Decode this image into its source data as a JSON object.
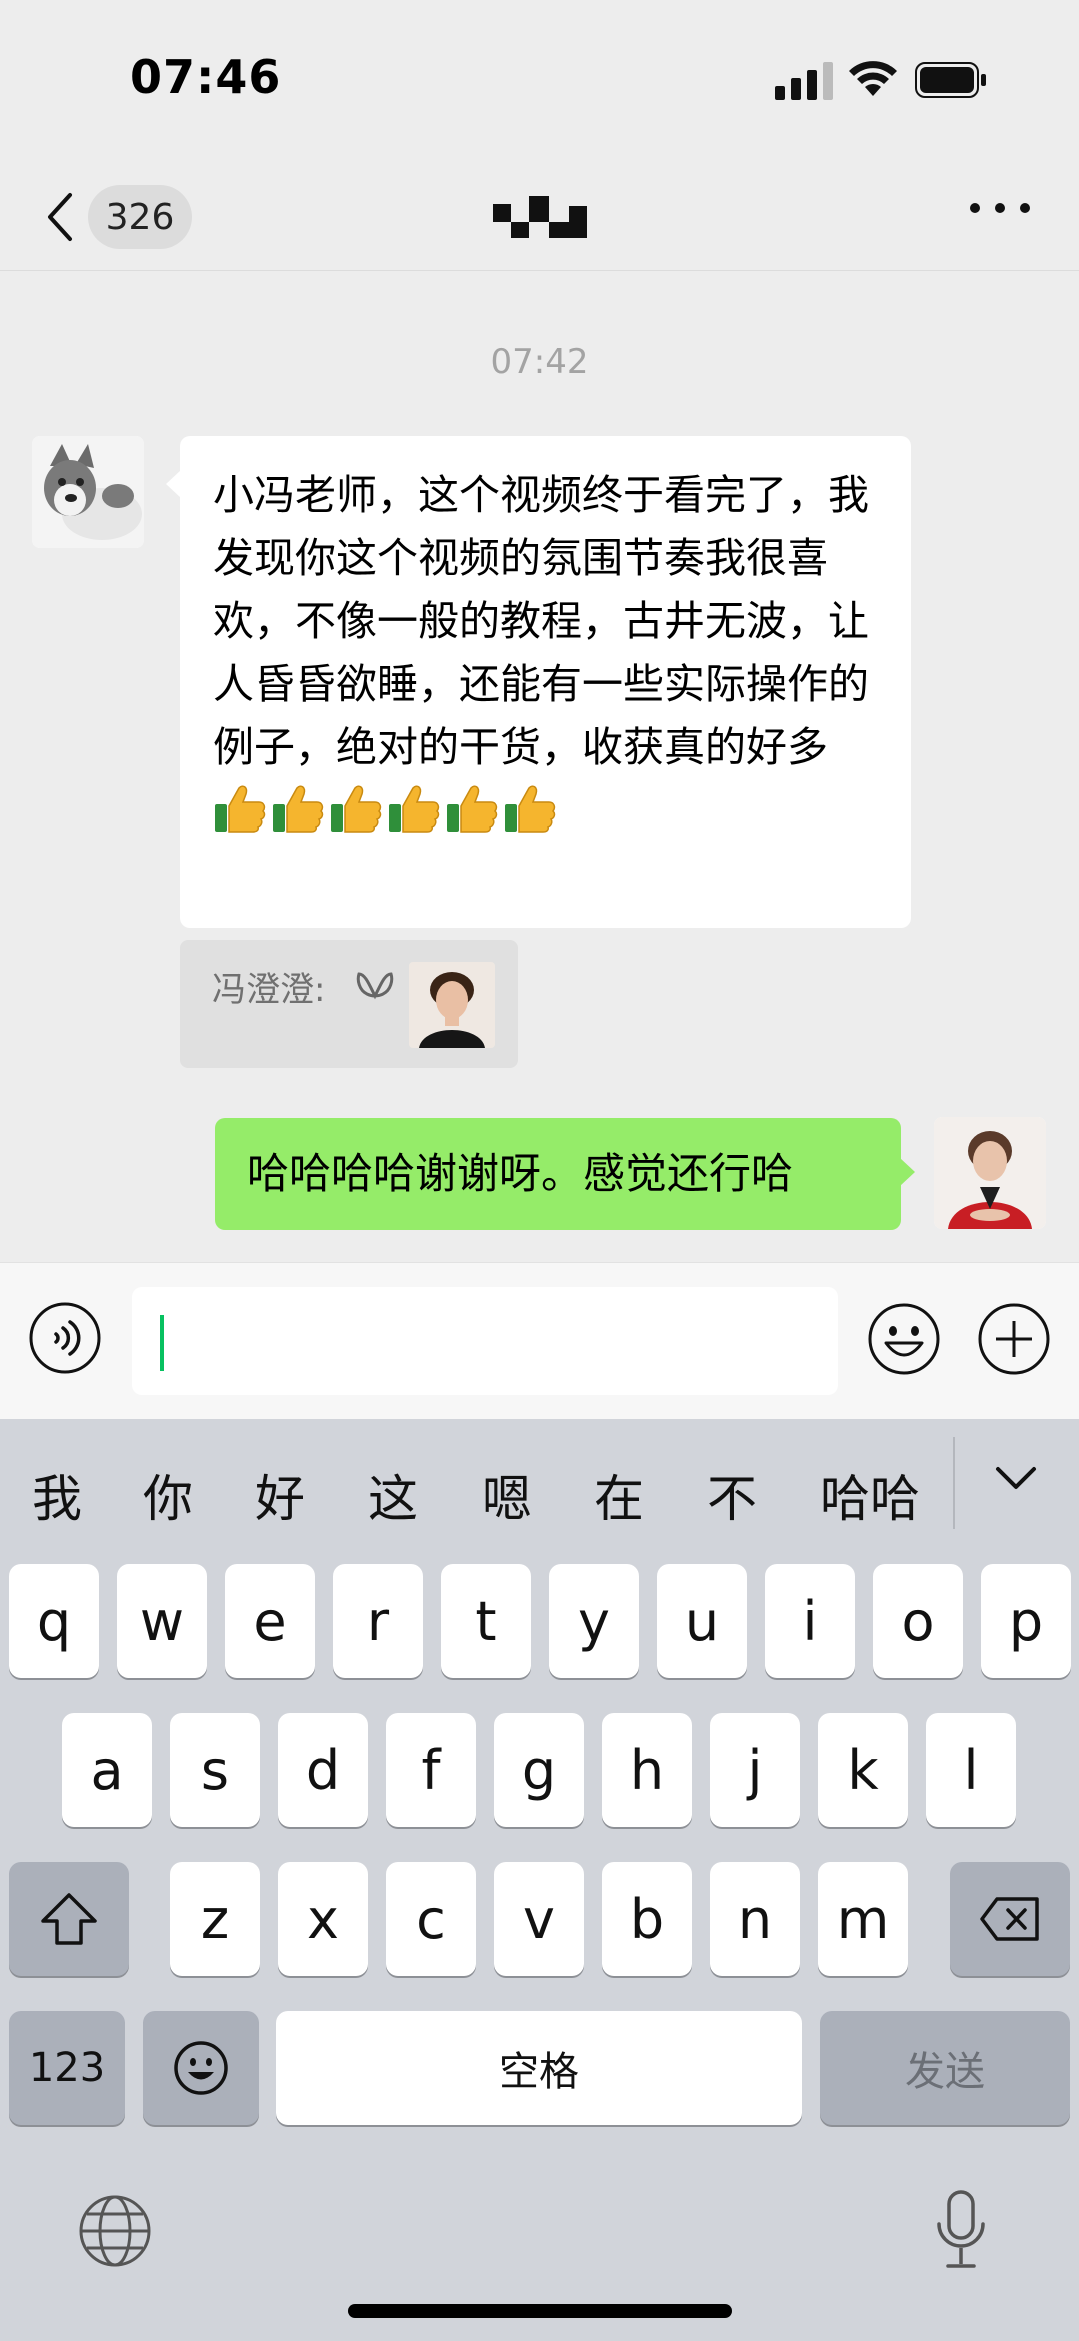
{
  "status_bar": {
    "time": "07:46"
  },
  "nav": {
    "unread_count": "326"
  },
  "chat": {
    "timestamp": "07:42",
    "incoming": {
      "text": "小冯老师，这个视频终于看完了，我发现你这个视频的氛围节奏我很喜欢，不像一般的教程，古井无波，让人昏昏欲睡，还能有一些实际操作的例子，绝对的干货，收获真的好多",
      "emoji": "thumbs-up-icon",
      "emoji_count": 6
    },
    "quote": {
      "name": "冯澄澄:"
    },
    "outgoing": {
      "text": "哈哈哈哈谢谢呀。感觉还行哈"
    }
  },
  "input": {
    "value": ""
  },
  "keyboard": {
    "candidates": [
      "我",
      "你",
      "好",
      "这",
      "嗯",
      "在",
      "不",
      "哈哈"
    ],
    "row1": [
      "q",
      "w",
      "e",
      "r",
      "t",
      "y",
      "u",
      "i",
      "o",
      "p"
    ],
    "row2": [
      "a",
      "s",
      "d",
      "f",
      "g",
      "h",
      "j",
      "k",
      "l"
    ],
    "row3": [
      "z",
      "x",
      "c",
      "v",
      "b",
      "n",
      "m"
    ],
    "num_label": "123",
    "space_label": "空格",
    "send_label": "发送"
  },
  "colors": {
    "outgoing_bubble": "#95ec69",
    "background": "#ededed",
    "keyboard": "#d1d4da",
    "caret": "#07c160"
  }
}
